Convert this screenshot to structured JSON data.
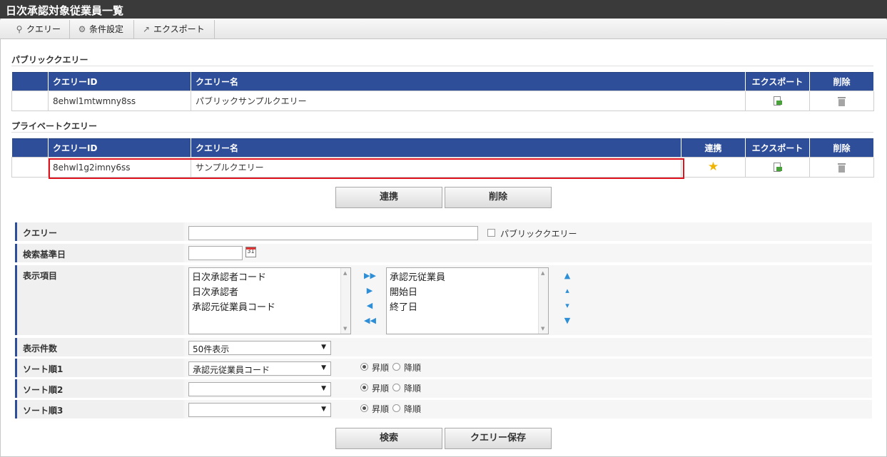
{
  "window": {
    "title": "日次承認対象従業員一覧"
  },
  "toolbar": {
    "query": "クエリー",
    "conditions": "条件設定",
    "export": "エクスポート"
  },
  "public": {
    "section_title": "パブリッククエリー",
    "headers": {
      "id": "クエリーID",
      "name": "クエリー名",
      "export": "エクスポート",
      "delete": "削除"
    },
    "rows": [
      {
        "id": "8ehwl1mtwmny8ss",
        "name": "パブリックサンプルクエリー"
      }
    ]
  },
  "private": {
    "section_title": "プライベートクエリー",
    "headers": {
      "id": "クエリーID",
      "name": "クエリー名",
      "link": "連携",
      "export": "エクスポート",
      "delete": "削除"
    },
    "rows": [
      {
        "id": "8ehwl1g2imny6ss",
        "name": "サンプルクエリー"
      }
    ]
  },
  "actions": {
    "link": "連携",
    "delete": "削除"
  },
  "form": {
    "query_label": "クエリー",
    "query_value": "",
    "public_checkbox_label": "パブリッククエリー",
    "base_date_label": "検索基準日",
    "base_date_value": "",
    "calendar_day": "31",
    "display_items_label": "表示項目",
    "available_items": [
      "日次承認者コード",
      "日次承認者",
      "承認元従業員コード"
    ],
    "selected_items": [
      "承認元従業員",
      "開始日",
      "終了日"
    ],
    "count_label": "表示件数",
    "count_value": "50件表示",
    "sort1_label": "ソート順1",
    "sort1_value": "承認元従業員コード",
    "sort2_label": "ソート順2",
    "sort2_value": "",
    "sort3_label": "ソート順3",
    "sort3_value": "",
    "asc_label": "昇順",
    "desc_label": "降順"
  },
  "bottom": {
    "search": "検索",
    "save": "クエリー保存"
  }
}
